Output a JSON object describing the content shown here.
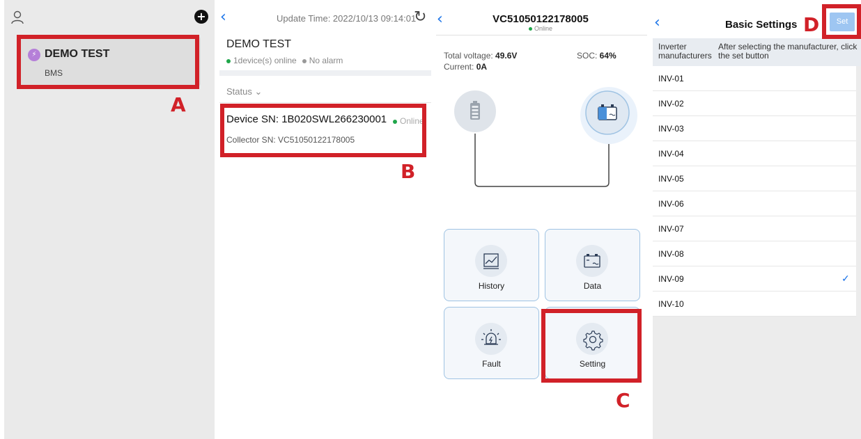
{
  "panel1": {
    "group_name": "DEMO TEST",
    "group_type": "BMS",
    "icon_user": "user-icon",
    "icon_add": "add-icon"
  },
  "panel2": {
    "update_time": "Update Time:  2022/10/13 09:14:01",
    "title": "DEMO TEST",
    "online_summary": "1device(s) online",
    "alarm_summary": "No alarm",
    "status_filter": "Status",
    "device_sn": "Device SN:  1B020SWL266230001",
    "device_status": "Online",
    "collector_sn": "Collector SN:  VC51050122178005"
  },
  "panel3": {
    "title": "VC51050122178005",
    "status": "Online",
    "total_voltage_label": "Total voltage: ",
    "total_voltage_value": "49.6V",
    "soc_label": "SOC: ",
    "soc_value": "64%",
    "current_label": "Current: ",
    "current_value": "0A",
    "tiles": {
      "history": "History",
      "data": "Data",
      "fault": "Fault",
      "setting": "Setting"
    }
  },
  "panel4": {
    "title": "Basic Settings",
    "set_button": "Set",
    "col1": "Inverter manufacturers",
    "col2": "After selecting the manufacturer, click the set button",
    "items": [
      "INV-01",
      "INV-02",
      "INV-03",
      "INV-04",
      "INV-05",
      "INV-06",
      "INV-07",
      "INV-08",
      "INV-09",
      "INV-10"
    ],
    "selected": "INV-09"
  },
  "callouts": {
    "a": "A",
    "b": "B",
    "c": "C",
    "d": "D"
  },
  "colors": {
    "callout": "#d12128",
    "accent": "#1a73e8",
    "online": "#1fa64a"
  }
}
